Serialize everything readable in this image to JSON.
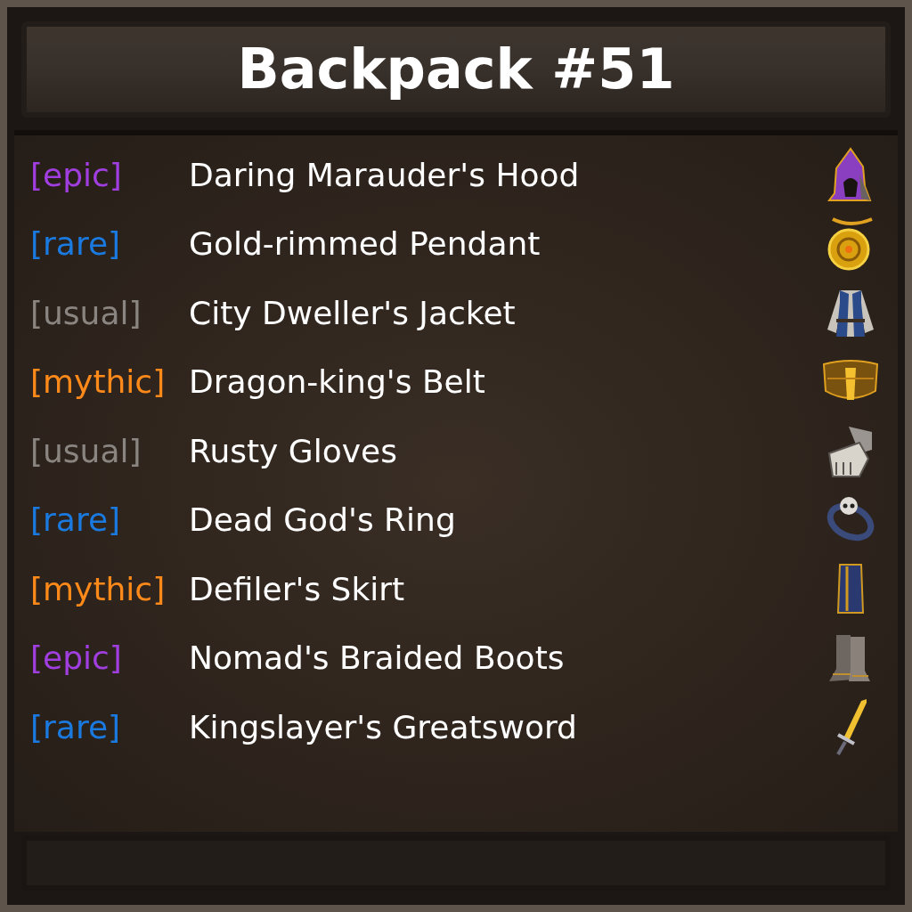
{
  "title": "Backpack #51",
  "items": [
    {
      "rarity": "[epic]",
      "color": "#a03ee0",
      "name": "Daring Marauder's Hood",
      "kind": "hood"
    },
    {
      "rarity": "[rare]",
      "color": "#1a7ae0",
      "name": "Gold-rimmed Pendant",
      "kind": "pendant"
    },
    {
      "rarity": "[usual]",
      "color": "#8a8580",
      "name": "City Dweller's Jacket",
      "kind": "jacket"
    },
    {
      "rarity": "[mythic]",
      "color": "#ff8a1a",
      "name": "Dragon-king's Belt",
      "kind": "belt"
    },
    {
      "rarity": "[usual]",
      "color": "#8a8580",
      "name": "Rusty Gloves",
      "kind": "gloves"
    },
    {
      "rarity": "[rare]",
      "color": "#1a7ae0",
      "name": "Dead God's Ring",
      "kind": "ring"
    },
    {
      "rarity": "[mythic]",
      "color": "#ff8a1a",
      "name": "Defiler's Skirt",
      "kind": "skirt"
    },
    {
      "rarity": "[epic]",
      "color": "#a03ee0",
      "name": "Nomad's Braided Boots",
      "kind": "boots"
    },
    {
      "rarity": "[rare]",
      "color": "#1a7ae0",
      "name": "Kingslayer's Greatsword",
      "kind": "sword"
    }
  ]
}
